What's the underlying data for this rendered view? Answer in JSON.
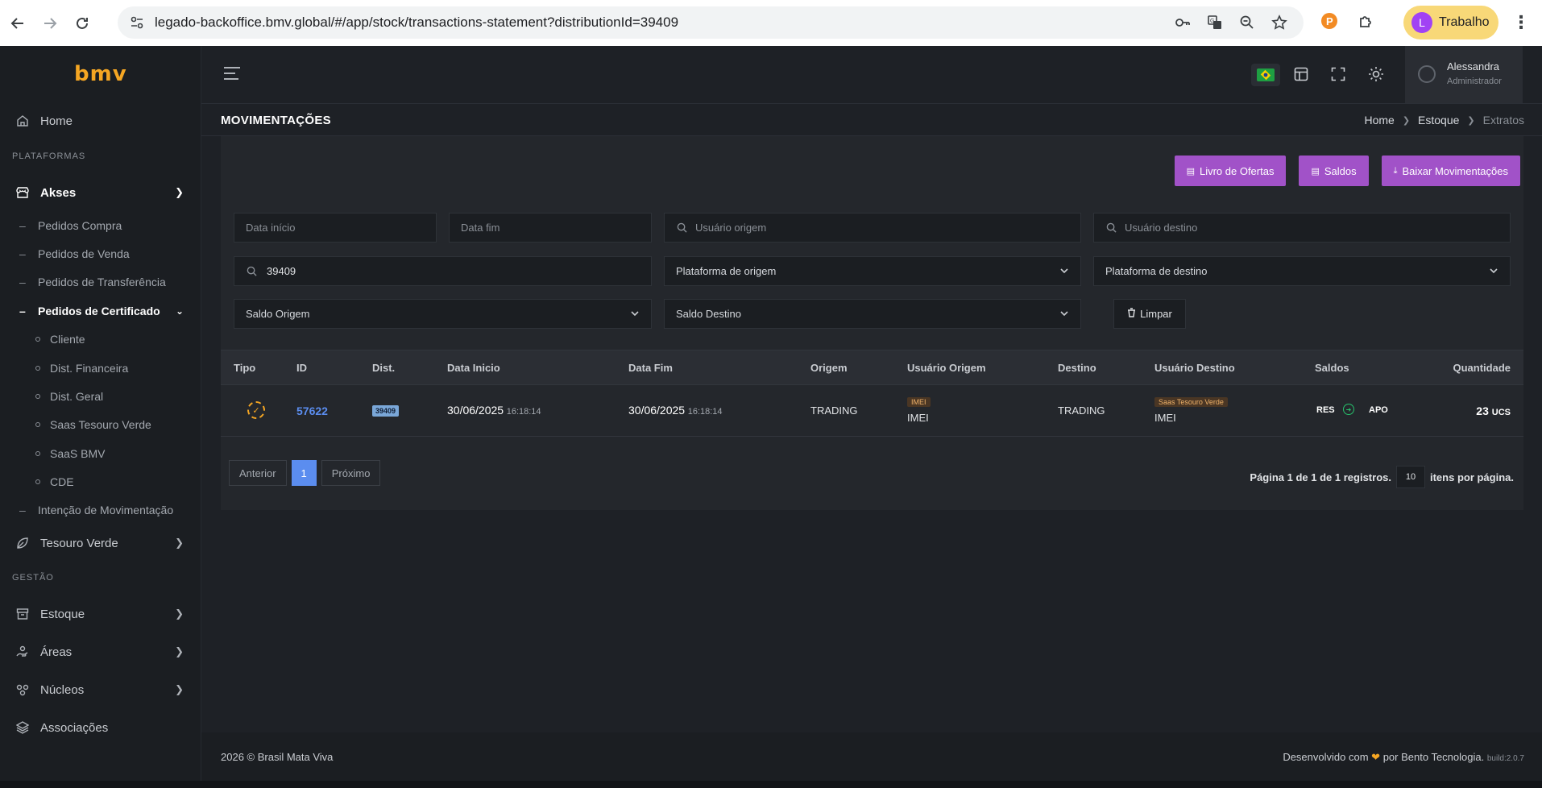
{
  "browser": {
    "url": "legado-backoffice.bmv.global/#/app/stock/transactions-statement?distributionId=39409",
    "profile_initial": "L",
    "profile_name": "Trabalho"
  },
  "sidebar": {
    "logo": "bmv",
    "home": "Home",
    "section_platforms": "PLATAFORMAS",
    "akses": "Akses",
    "akses_items": [
      "Pedidos Compra",
      "Pedidos de Venda",
      "Pedidos de Transferência"
    ],
    "cert_orders": "Pedidos de Certificado",
    "cert_items": [
      "Cliente",
      "Dist. Financeira",
      "Dist. Geral",
      "Saas Tesouro Verde",
      "SaaS BMV",
      "CDE"
    ],
    "movement_intent": "Intenção de Movimentação",
    "tesouro_verde": "Tesouro Verde",
    "section_management": "GESTÃO",
    "estoque": "Estoque",
    "areas": "Áreas",
    "nucleos": "Núcleos",
    "associacoes": "Associações"
  },
  "header": {
    "user_name": "Alessandra",
    "user_role": "Administrador"
  },
  "page": {
    "title": "MOVIMENTAÇÕES",
    "breadcrumb": [
      "Home",
      "Estoque",
      "Extratos"
    ]
  },
  "actions": {
    "offers": "Livro de Ofertas",
    "balances": "Saldos",
    "download": "Baixar Movimentações"
  },
  "filters": {
    "start_date_ph": "Data início",
    "end_date_ph": "Data fim",
    "origin_user_ph": "Usuário origem",
    "dest_user_ph": "Usuário destino",
    "search_value": "39409",
    "origin_platform": "Plataforma de origem",
    "dest_platform": "Plataforma de destino",
    "origin_balance": "Saldo Origem",
    "dest_balance": "Saldo Destino",
    "clear": "Limpar"
  },
  "table": {
    "columns": [
      "Tipo",
      "ID",
      "Dist.",
      "Data Inicio",
      "Data Fim",
      "Origem",
      "Usuário Origem",
      "Destino",
      "Usuário Destino",
      "Saldos",
      "Quantidade"
    ],
    "rows": [
      {
        "id": "57622",
        "dist": "39409",
        "start_date": "30/06/2025",
        "start_time": "16:18:14",
        "end_date": "30/06/2025",
        "end_time": "16:18:14",
        "origin": "TRADING",
        "origin_user_badge": "IMEI",
        "origin_user": "IMEI",
        "destination": "TRADING",
        "dest_user_badge": "Saas Tesouro Verde",
        "dest_user": "IMEI",
        "balance_from": "RES",
        "balance_to": "APO",
        "quantity": "23",
        "unit": "UCS"
      }
    ]
  },
  "pagination": {
    "prev": "Anterior",
    "current": "1",
    "next": "Próximo",
    "info": "Página 1 de 1 de 1 registros.",
    "page_size": "10",
    "per_page": "itens por página."
  },
  "footer": {
    "copyright": "2026 © Brasil Mata Viva",
    "dev_prefix": "Desenvolvido com",
    "dev_suffix": "por Bento Tecnologia.",
    "build": "build:2.0.7"
  }
}
